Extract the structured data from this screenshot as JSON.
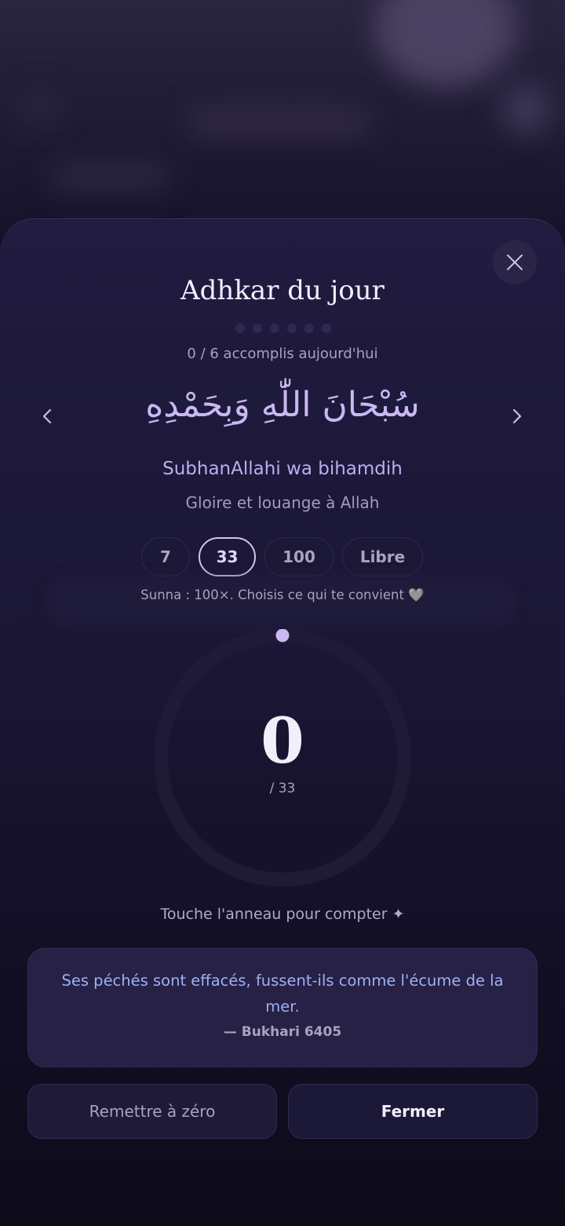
{
  "sheet": {
    "title": "Adhkar du jour",
    "progress_text": "0 / 6 accomplis aujourd'hui",
    "dots_total": 6,
    "dots_done": 0
  },
  "dhikr": {
    "arabic": "سُبْحَانَ اللّٰهِ وَبِحَمْدِهِ",
    "transliteration": "SubhanAllahi wa bihamdih",
    "translation": "Gloire et louange à Allah"
  },
  "count_options": [
    {
      "label": "7",
      "selected": false
    },
    {
      "label": "33",
      "selected": true
    },
    {
      "label": "100",
      "selected": false
    },
    {
      "label": "Libre",
      "selected": false
    }
  ],
  "sunna_hint": "Sunna : 100×. Choisis ce qui te convient 🩶",
  "counter": {
    "value": "0",
    "target_label": "/ 33",
    "progress": 0
  },
  "tap_hint": "Touche l'anneau pour compter ✦",
  "quote": {
    "text": "Ses péchés sont effacés, fussent-ils comme l'écume de la mer.",
    "source": "— Bukhari 6405"
  },
  "buttons": {
    "reset": "Remettre à zéro",
    "close": "Fermer"
  },
  "icons": {
    "close": "close-icon",
    "prev": "chevron-left-icon",
    "next": "chevron-right-icon"
  },
  "colors": {
    "accent": "#c9b8f2",
    "quote": "#9fb0f4",
    "ring_track": "#1f1b36"
  }
}
